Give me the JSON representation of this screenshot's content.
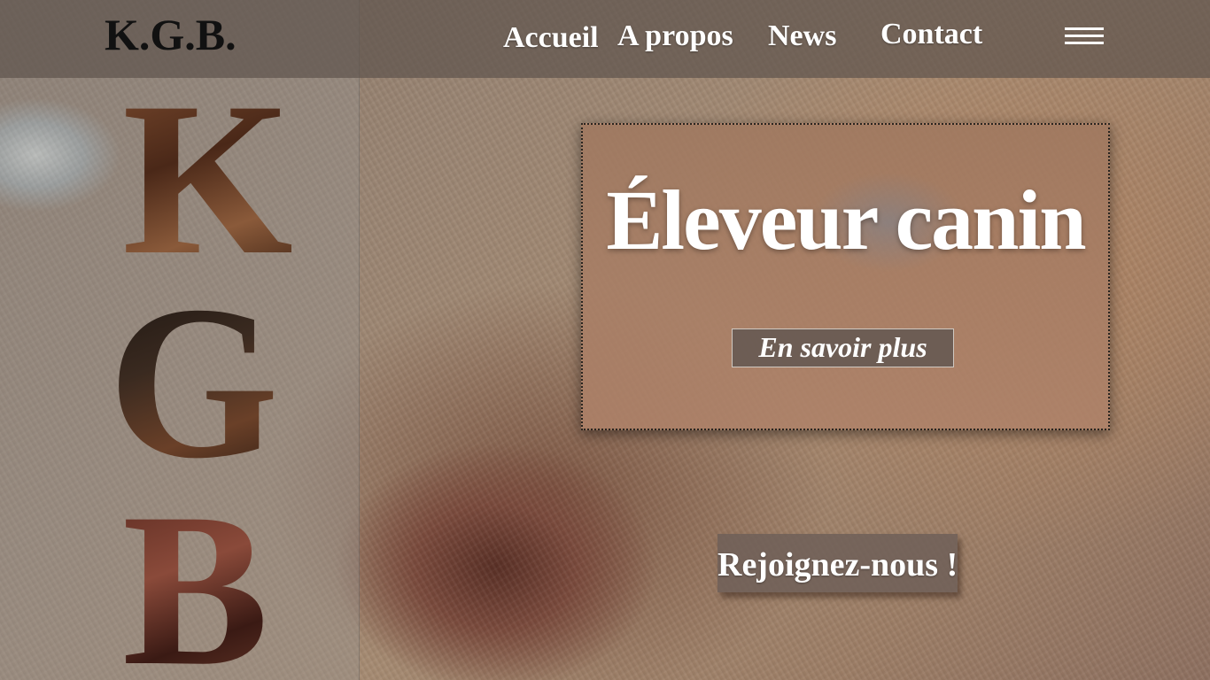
{
  "header": {
    "logo_text": "K.G.B.",
    "nav": {
      "accueil": "Accueil",
      "apropos": "A propos",
      "news": "News",
      "contact": "Contact"
    },
    "menu_icon": "hamburger-menu-icon"
  },
  "sidebar": {
    "letters": [
      "K",
      "G",
      "B"
    ]
  },
  "hero": {
    "title": "Éleveur canin",
    "button_label": "En savoir plus"
  },
  "cta": {
    "join_label": "Rejoignez-nous !"
  },
  "colors": {
    "nav_text": "#ffffff",
    "logo_text": "#111111",
    "topbar_bg": "#5f554e",
    "button_bg": "#5f5550"
  }
}
